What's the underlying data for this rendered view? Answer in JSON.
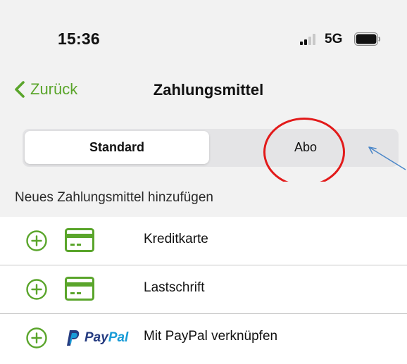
{
  "status_bar": {
    "time": "15:36",
    "network": "5G",
    "signal_icon": "cellular-signal-icon",
    "battery_icon": "battery-icon"
  },
  "nav": {
    "back_label": "Zurück",
    "back_icon": "chevron-left-icon",
    "title": "Zahlungsmittel"
  },
  "segments": {
    "items": [
      {
        "label": "Standard",
        "selected": true
      },
      {
        "label": "Abo",
        "selected": false
      }
    ]
  },
  "section": {
    "header": "Neues Zahlungsmittel hinzufügen"
  },
  "payment_methods": [
    {
      "label": "Kreditkarte",
      "icon": "credit-card-icon"
    },
    {
      "label": "Lastschrift",
      "icon": "credit-card-icon"
    },
    {
      "label": "Mit PayPal verknüpfen",
      "icon": "paypal-logo",
      "logo_text_main": "Pay",
      "logo_text_accent": "Pal"
    }
  ],
  "colors": {
    "accent_green": "#5aa52b",
    "annotation_red": "#e21a1a",
    "annotation_arrow_blue": "#4a86c8",
    "paypal_dark": "#253b80",
    "paypal_light": "#179bd7"
  }
}
